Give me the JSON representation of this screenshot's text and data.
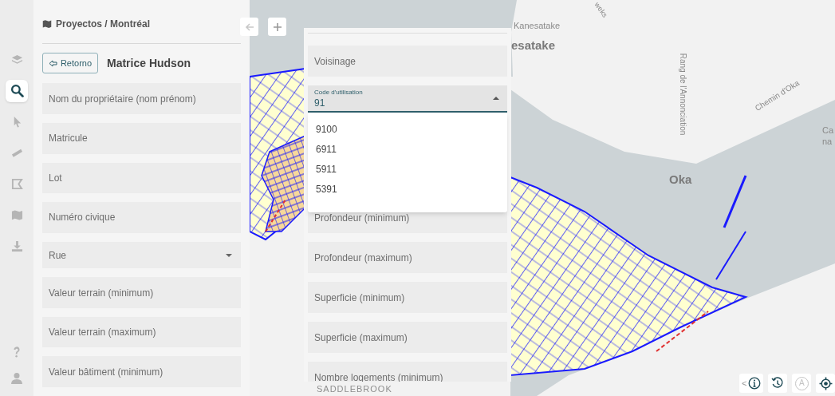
{
  "rail": {
    "items": [
      {
        "kind": "layers",
        "selected": false
      },
      {
        "kind": "search",
        "selected": true
      },
      {
        "kind": "pointer",
        "selected": false
      },
      {
        "kind": "ruler",
        "selected": false
      },
      {
        "kind": "polygon",
        "selected": false
      },
      {
        "kind": "map",
        "selected": false
      },
      {
        "kind": "download",
        "selected": false
      }
    ],
    "bottom_items": [
      {
        "kind": "help"
      },
      {
        "kind": "user"
      }
    ]
  },
  "breadcrumb": "Proyectos / Montréal",
  "back_button": "Retorno",
  "title": "Matrice Hudson",
  "left_fields": [
    {
      "kind": "text",
      "placeholder": "Nom du propriétaire (nom prénom)"
    },
    {
      "kind": "text",
      "placeholder": "Matricule"
    },
    {
      "kind": "text",
      "placeholder": "Lot"
    },
    {
      "kind": "text",
      "placeholder": "Numéro civique"
    },
    {
      "kind": "select",
      "placeholder": "Rue",
      "expanded": false
    },
    {
      "kind": "text",
      "placeholder": "Valeur terrain (minimum)"
    },
    {
      "kind": "text",
      "placeholder": "Valeur terrain (maximum)"
    },
    {
      "kind": "text",
      "placeholder": "Valeur bâtiment (minimum)"
    }
  ],
  "map_nav": [
    {
      "kind": "back",
      "disabled": true
    },
    {
      "kind": "plus",
      "disabled": false
    }
  ],
  "middle_fields": [
    {
      "kind": "text",
      "placeholder": "Voisinage"
    },
    {
      "kind": "select",
      "label": "Code d'utilisation",
      "value": "91",
      "expanded": true,
      "options": [
        {
          "label": "9100",
          "selected": false
        },
        {
          "label": "6911",
          "selected": false
        },
        {
          "label": "5911",
          "selected": false
        },
        {
          "label": "5391",
          "selected": false
        }
      ]
    },
    {
      "kind": "text",
      "placeholder": "Profondeur (minimum)"
    },
    {
      "kind": "text",
      "placeholder": "Profondeur (maximum)"
    },
    {
      "kind": "text",
      "placeholder": "Superficie (minimum)"
    },
    {
      "kind": "text",
      "placeholder": "Superficie (maximum)"
    },
    {
      "kind": "text",
      "placeholder": "Nombre logements (minimum)"
    }
  ],
  "map_labels": [
    {
      "kind": "road",
      "text": "weks"
    },
    {
      "kind": "place",
      "text": "Kanesatake"
    },
    {
      "kind": "town",
      "text": "esatake"
    },
    {
      "kind": "road",
      "text": "Rang de l'Annonciation"
    },
    {
      "kind": "road",
      "text": "Chemin d'Oka"
    },
    {
      "kind": "town",
      "text": "Oka"
    },
    {
      "kind": "place",
      "text": "Ca"
    },
    {
      "kind": "place",
      "text": "na"
    },
    {
      "kind": "area",
      "text": "SADDLEBROOK"
    }
  ],
  "map_controls": [
    {
      "kind": "info",
      "prefix": "<",
      "disabled": false
    },
    {
      "kind": "history",
      "disabled": false
    },
    {
      "kind": "letter",
      "text": "A",
      "disabled": true
    },
    {
      "kind": "locate",
      "disabled": false
    }
  ]
}
